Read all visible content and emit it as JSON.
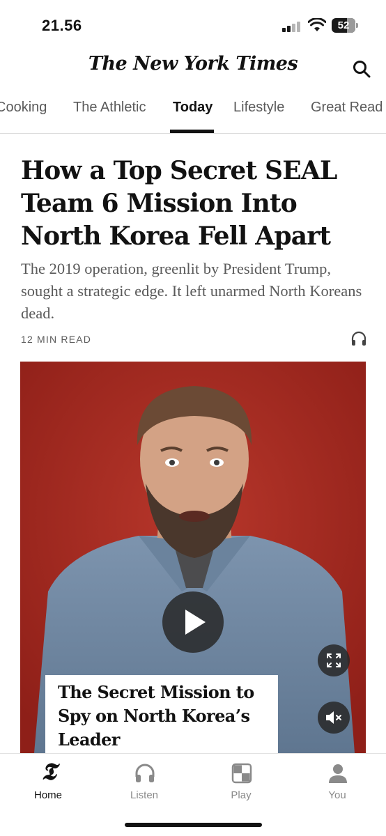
{
  "status_bar": {
    "time": "21.56",
    "battery": "52"
  },
  "masthead": {
    "logo": "The New York Times",
    "search_icon": "search-icon"
  },
  "tabs": [
    {
      "label": "Cooking",
      "active": false
    },
    {
      "label": "The Athletic",
      "active": false
    },
    {
      "label": "Today",
      "active": true
    },
    {
      "label": "Lifestyle",
      "active": false
    },
    {
      "label": "Great Read",
      "active": false
    }
  ],
  "article": {
    "headline": "How a Top Secret SEAL Team 6 Mission Into North Korea Fell Apart",
    "summary": "The 2019 operation, greenlit by President Trump, sought a strategic edge. It left unarmed North Koreans dead.",
    "read_time": "12 MIN READ",
    "listen_icon": "headphones-icon"
  },
  "video": {
    "caption": "The Secret Mission to Spy on North Korea’s Leader",
    "play_icon": "play-icon",
    "fullscreen_icon": "expand-icon",
    "mute_icon": "speaker-muted-icon"
  },
  "bottom_nav": [
    {
      "label": "Home",
      "icon": "nyt-t-logo-icon",
      "active": true
    },
    {
      "label": "Listen",
      "icon": "headphones-icon",
      "active": false
    },
    {
      "label": "Play",
      "icon": "games-grid-icon",
      "active": false
    },
    {
      "label": "You",
      "icon": "person-icon",
      "active": false
    }
  ],
  "colors": {
    "video_background": "#a7291f",
    "text_primary": "#121212",
    "text_secondary": "#5a5a5a",
    "nav_inactive": "#8a8a8a"
  }
}
